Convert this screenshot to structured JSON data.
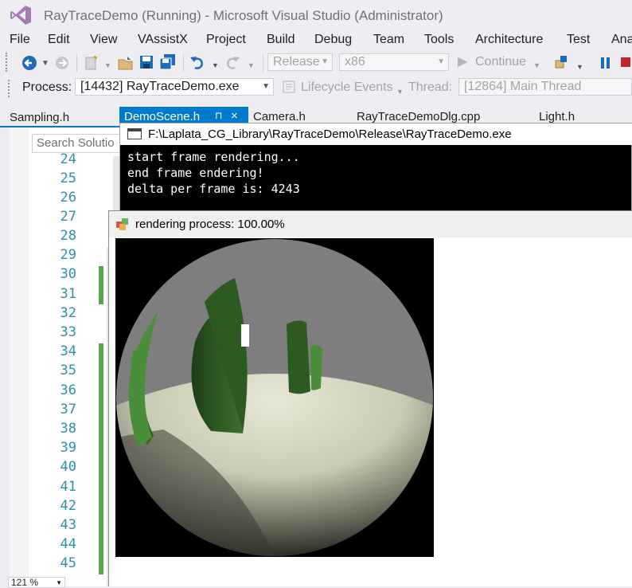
{
  "window": {
    "title": "RayTraceDemo (Running) - Microsoft Visual Studio (Administrator)"
  },
  "menu": [
    "File",
    "Edit",
    "View",
    "VAssistX",
    "Project",
    "Build",
    "Debug",
    "Team",
    "Tools",
    "Architecture",
    "Test",
    "Ana"
  ],
  "toolbar": {
    "config": "Release",
    "platform": "x86",
    "continue_label": "Continue"
  },
  "debug_bar": {
    "process_label": "Process:",
    "process_value": "[14432] RayTraceDemo.exe",
    "lifecycle_label": "Lifecycle Events",
    "thread_label": "Thread:",
    "thread_value": "[12864] Main Thread"
  },
  "tabs": [
    "Sampling.h",
    "DemoScene.h",
    "Camera.h",
    "RayTraceDemoDlg.cpp",
    "Light.h"
  ],
  "editor": {
    "search_placeholder": "Search Solutio",
    "line_numbers": [
      "24",
      "25",
      "26",
      "27",
      "28",
      "29",
      "30",
      "31",
      "32",
      "33",
      "34",
      "35",
      "36",
      "37",
      "38",
      "39",
      "40",
      "41",
      "42",
      "43",
      "44",
      "45"
    ],
    "zoom": "121 %"
  },
  "console": {
    "title": "F:\\Laplata_CG_Library\\RayTraceDemo\\Release\\RayTraceDemo.exe",
    "lines": [
      "start frame rendering...",
      "end frame endering!",
      "delta per frame is: 4243"
    ]
  },
  "render_window": {
    "title": "rendering process: 100.00%"
  },
  "colors": {
    "accent": "#007acc",
    "change_bar": "#57a64a",
    "line_number": "#2b91af"
  }
}
